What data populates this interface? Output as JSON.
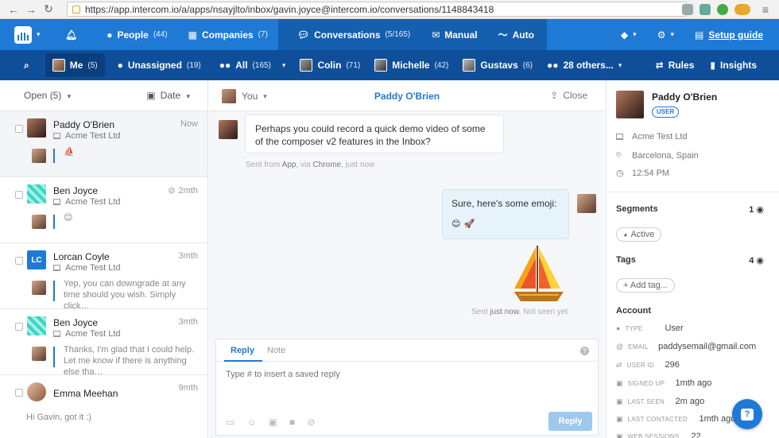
{
  "browser": {
    "url": "https://app.intercom.io/a/apps/nsayjlto/inbox/gavin.joyce@intercom.io/conversations/1148843418"
  },
  "topnav": {
    "people_label": "People",
    "people_count": "(44)",
    "companies_label": "Companies",
    "companies_count": "(7)",
    "conversations_label": "Conversations",
    "conversations_count": "(5/165)",
    "manual_label": "Manual",
    "auto_label": "Auto",
    "setup_label": "Setup guide"
  },
  "subnav": {
    "me_label": "Me",
    "me_count": "(5)",
    "unassigned_label": "Unassigned",
    "unassigned_count": "(19)",
    "all_label": "All",
    "all_count": "(165)",
    "colin_label": "Colin",
    "colin_count": "(71)",
    "michelle_label": "Michelle",
    "michelle_count": "(42)",
    "gustavs_label": "Gustavs",
    "gustavs_count": "(6)",
    "others_label": "28 others...",
    "rules_label": "Rules",
    "insights_label": "Insights"
  },
  "list": {
    "filter_label": "Open (5)",
    "sort_label": "Date",
    "conversations": [
      {
        "name": "Paddy O'Brien",
        "company": "Acme Test Ltd",
        "time": "Now",
        "snippet": "⛵"
      },
      {
        "name": "Ben Joyce",
        "company": "Acme Test Ltd",
        "time": "2mth",
        "snippet": "😊"
      },
      {
        "name": "Lorcan Coyle",
        "company": "Acme Test Ltd",
        "time": "3mth",
        "snippet": "Yep, you can downgrade at any time should you wish. Simply click…",
        "initials": "LC"
      },
      {
        "name": "Ben Joyce",
        "company": "Acme Test Ltd",
        "time": "3mth",
        "snippet": "Thanks, I'm glad that I could help. Let me know if there is anything else tha…"
      },
      {
        "name": "Emma Meehan",
        "company": "",
        "time": "9mth",
        "snippet": "Hi Gavin, got it :)"
      }
    ]
  },
  "conversation": {
    "assignee_label": "You",
    "title": "Paddy O'Brien",
    "close_label": "Close",
    "incoming_text": "Perhaps you could record a quick demo video of some of the composer v2 features in the Inbox?",
    "incoming_meta_prefix": "Sent from",
    "incoming_meta_app": "App",
    "incoming_meta_via": ", via",
    "incoming_meta_browser": "Chrome",
    "incoming_meta_time": ", just now",
    "outgoing_text": "Sure, here's some emoji:",
    "outgoing_emoji": "😊🚀",
    "outgoing_meta_prefix": "Sent",
    "outgoing_meta_time": "just now.",
    "outgoing_meta_status": "Not seen yet"
  },
  "composer": {
    "tab_reply": "Reply",
    "tab_note": "Note",
    "placeholder": "Type # to insert a saved reply",
    "send_label": "Reply"
  },
  "profile": {
    "name": "Paddy O'Brien",
    "badge": "USER",
    "company": "Acme Test Ltd",
    "location": "Barcelona, Spain",
    "local_time": "12:54 PM",
    "segments_label": "Segments",
    "segments_count": "1",
    "segment_active": "Active",
    "tags_label": "Tags",
    "tags_count": "4",
    "add_tag_label": "+ Add tag...",
    "account_label": "Account",
    "attributes": [
      {
        "key": "TYPE",
        "value": "User"
      },
      {
        "key": "EMAIL",
        "value": "paddysemail@gmail.com"
      },
      {
        "key": "USER ID",
        "value": "296"
      },
      {
        "key": "SIGNED UP",
        "value": "1mth ago"
      },
      {
        "key": "LAST SEEN",
        "value": "2m ago"
      },
      {
        "key": "LAST CONTACTED",
        "value": "1mth ago"
      },
      {
        "key": "WEB SESSIONS",
        "value": "22"
      }
    ]
  },
  "colors": {
    "topnav_bg": "#1f7ad6",
    "subnav_bg": "#0f4f9a",
    "accent": "#1f7ad6"
  }
}
